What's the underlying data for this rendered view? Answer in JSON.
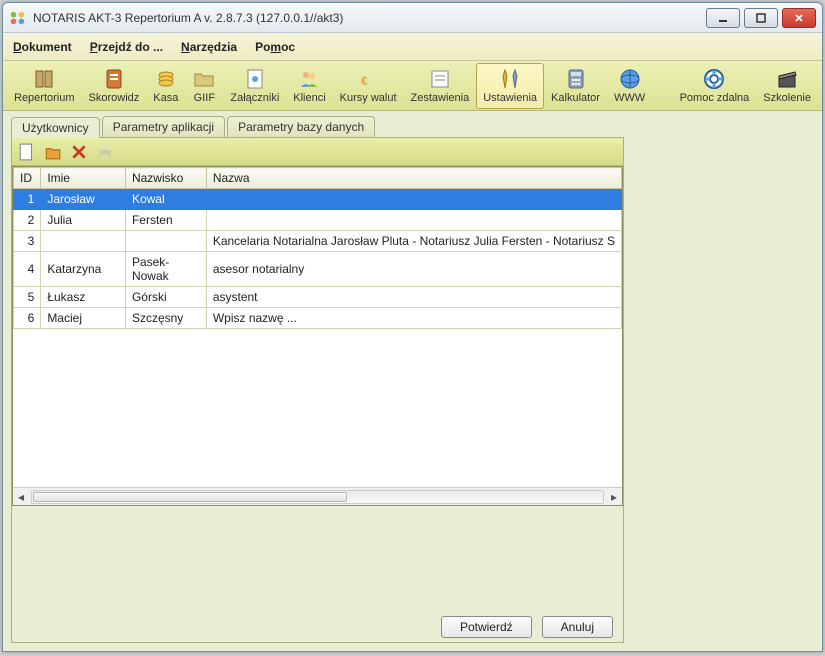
{
  "window": {
    "title": "NOTARIS AKT-3 Repertorium A v. 2.8.7.3 (127.0.0.1//akt3)"
  },
  "menu": {
    "dokument": "Dokument",
    "przejdz": "Przejdź do ...",
    "narzedzia": "Narzędzia",
    "pomoc": "Pomoc"
  },
  "toolbar": {
    "repertorium": "Repertorium",
    "skorowidz": "Skorowidz",
    "kasa": "Kasa",
    "giif": "GIIF",
    "zalaczniki": "Załączniki",
    "klienci": "Klienci",
    "kursy": "Kursy walut",
    "zestawienia": "Zestawienia",
    "ustawienia": "Ustawienia",
    "kalkulator": "Kalkulator",
    "www": "WWW",
    "pomoc_zdalna": "Pomoc zdalna",
    "szkolenie": "Szkolenie"
  },
  "tabs": {
    "uzytkownicy": "Użytkownicy",
    "parametry_app": "Parametry aplikacji",
    "parametry_db": "Parametry bazy danych"
  },
  "grid": {
    "headers": {
      "id": "ID",
      "imie": "Imie",
      "nazwisko": "Nazwisko",
      "nazwa": "Nazwa"
    },
    "rows": [
      {
        "id": "1",
        "imie": "Jarosław",
        "nazwisko": "Kowal",
        "nazwa": ""
      },
      {
        "id": "2",
        "imie": "Julia",
        "nazwisko": "Fersten",
        "nazwa": ""
      },
      {
        "id": "3",
        "imie": "",
        "nazwisko": "",
        "nazwa": "Kancelaria Notarialna Jarosław Pluta - Notariusz Julia Fersten - Notariusz S"
      },
      {
        "id": "4",
        "imie": "Katarzyna",
        "nazwisko": "Pasek-Nowak",
        "nazwa": "asesor notarialny"
      },
      {
        "id": "5",
        "imie": "Łukasz",
        "nazwisko": "Górski",
        "nazwa": "asystent"
      },
      {
        "id": "6",
        "imie": "Maciej",
        "nazwisko": "Szczęsny",
        "nazwa": "Wpisz nazwę ..."
      }
    ]
  },
  "buttons": {
    "potwierdz": "Potwierdź",
    "anuluj": "Anuluj"
  }
}
